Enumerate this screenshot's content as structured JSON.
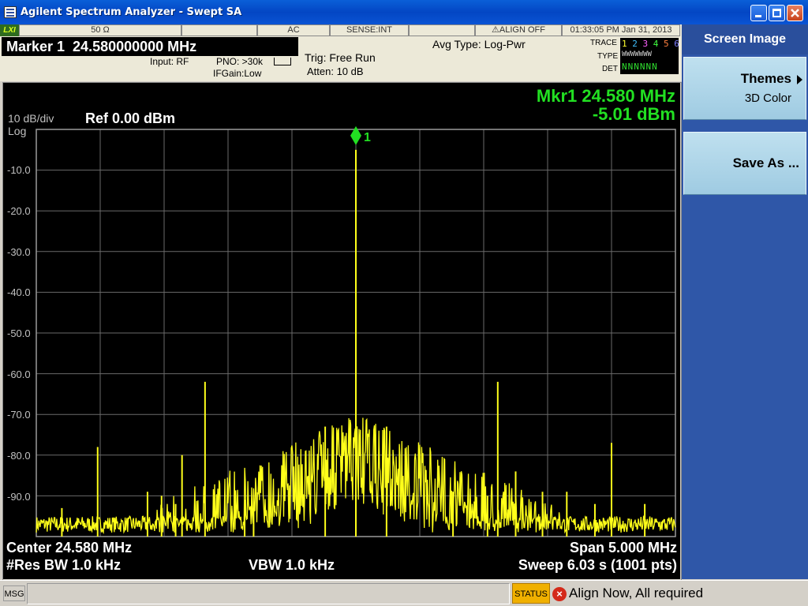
{
  "window": {
    "title": "Agilent Spectrum Analyzer - Swept SA"
  },
  "header": {
    "lxi": "LXI",
    "impedance": "50 Ω",
    "coupling": "AC",
    "sense": "SENSE:INT",
    "align": "⚠ALIGN OFF",
    "datetime": "01:33:05 PM Jan 31, 2013",
    "marker": "Marker 1  24.580000000 MHz",
    "input": "Input: RF",
    "pno": "PNO: >30k",
    "ifgain": "IFGain:Low",
    "trig": "Trig: Free Run",
    "atten": "Atten: 10 dB",
    "avg_type": "Avg Type: Log-Pwr",
    "trace_label": "TRACE",
    "type_label": "TYPE",
    "det_label": "DET",
    "trace_numbers": [
      "1",
      "2",
      "3",
      "4",
      "5",
      "6"
    ],
    "type_row": "WWWWWWW",
    "det_row": "NNNNNN"
  },
  "softkeys": {
    "title": "Screen Image",
    "themes_label": "Themes",
    "themes_value": "3D Color",
    "save_label": "Save As ..."
  },
  "display": {
    "scale": "10 dB/div",
    "log": "Log",
    "ref": "Ref 0.00 dBm",
    "mkr_freq": "Mkr1 24.580 MHz",
    "mkr_amp": "-5.01 dBm",
    "marker_id": "1",
    "center": "Center 24.580 MHz",
    "res_bw": "#Res BW 1.0 kHz",
    "vbw": "VBW 1.0 kHz",
    "span": "Span 5.000 MHz",
    "sweep": "Sweep  6.03 s (1001 pts)"
  },
  "status": {
    "msg": "MSG",
    "status_label": "STATUS",
    "text": "Align Now, All required"
  },
  "colors": {
    "trace": "#ffff1a",
    "marker": "#22e022",
    "grid": "#6a6a6a",
    "softkey_panel": "#2f57a8"
  },
  "chart_data": {
    "type": "line",
    "title": "",
    "xlabel": "",
    "ylabel": "",
    "x_center_mhz": 24.58,
    "x_span_mhz": 5.0,
    "xlim": [
      22.08,
      27.08
    ],
    "ylim": [
      -100,
      0
    ],
    "y_ticks": [
      "-10.0",
      "-20.0",
      "-30.0",
      "-40.0",
      "-50.0",
      "-60.0",
      "-70.0",
      "-80.0",
      "-90.0"
    ],
    "grid": true,
    "marker": {
      "x": 24.58,
      "y": -5.01,
      "label": "1"
    },
    "series": [
      {
        "values": [
          [
            22.28,
            -93
          ],
          [
            22.56,
            -78
          ],
          [
            22.95,
            -89
          ],
          [
            23.06,
            -90
          ],
          [
            23.17,
            -92
          ],
          [
            23.22,
            -80
          ],
          [
            23.4,
            -62
          ],
          [
            23.71,
            -91
          ],
          [
            23.78,
            -93
          ],
          [
            24.34,
            -73
          ],
          [
            24.58,
            -5.01
          ],
          [
            24.82,
            -73
          ],
          [
            25.34,
            -89
          ],
          [
            25.61,
            -90
          ],
          [
            25.69,
            -62
          ],
          [
            25.83,
            -84
          ],
          [
            26.04,
            -89
          ],
          [
            26.23,
            -89
          ],
          [
            26.45,
            -92
          ],
          [
            26.58,
            -77
          ],
          [
            26.84,
            -92
          ]
        ]
      }
    ]
  }
}
